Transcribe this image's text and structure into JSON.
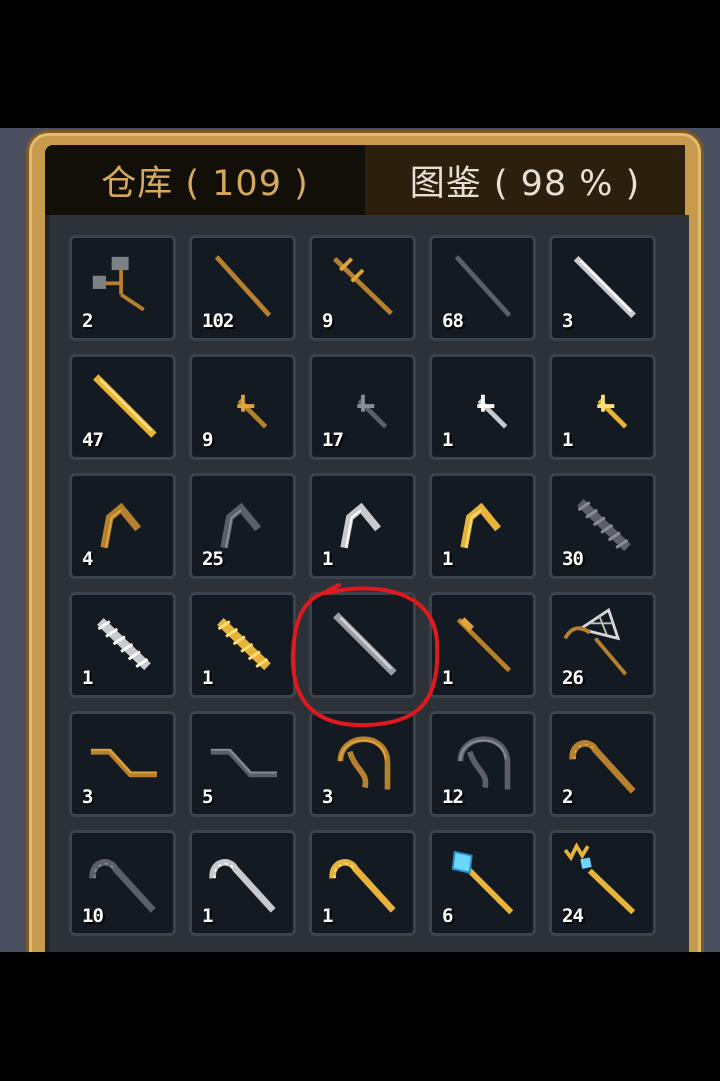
{
  "tabs": [
    {
      "label": "仓库 ( 109 )",
      "active": true
    },
    {
      "label": "图鉴 ( 98 % )",
      "active": false
    }
  ],
  "colors": {
    "frame_gold": "#c89a4e",
    "tab_active_text": "#d6a85a",
    "slot_bg": "#141a22",
    "highlight": "#e0191f"
  },
  "items": [
    {
      "icon": "hammer-icon",
      "count": "2"
    },
    {
      "icon": "wooden-staff-icon",
      "count": "102"
    },
    {
      "icon": "barbed-wooden-spear-icon",
      "count": "9"
    },
    {
      "icon": "iron-rod-icon",
      "count": "68"
    },
    {
      "icon": "steel-rod-icon",
      "count": "3"
    },
    {
      "icon": "golden-rod-icon",
      "count": "47"
    },
    {
      "icon": "wooden-dart-icon",
      "count": "9"
    },
    {
      "icon": "iron-dart-icon",
      "count": "17"
    },
    {
      "icon": "silver-dart-icon",
      "count": "1"
    },
    {
      "icon": "golden-dart-icon",
      "count": "1"
    },
    {
      "icon": "wooden-hook-icon",
      "count": "4"
    },
    {
      "icon": "iron-hook-icon",
      "count": "25"
    },
    {
      "icon": "silver-hook-icon",
      "count": "1"
    },
    {
      "icon": "golden-hook-icon",
      "count": "1"
    },
    {
      "icon": "spiked-club-icon",
      "count": "30"
    },
    {
      "icon": "silver-spiked-club-icon",
      "count": "1"
    },
    {
      "icon": "golden-spiked-club-icon",
      "count": "1"
    },
    {
      "icon": "steel-bar-icon",
      "count": "",
      "highlighted": true
    },
    {
      "icon": "wooden-spear-icon",
      "count": "1"
    },
    {
      "icon": "net-icon",
      "count": "26"
    },
    {
      "icon": "wooden-stairs-icon",
      "count": "3"
    },
    {
      "icon": "iron-stairs-icon",
      "count": "5"
    },
    {
      "icon": "wooden-whip-icon",
      "count": "3"
    },
    {
      "icon": "iron-whip-icon",
      "count": "12"
    },
    {
      "icon": "wooden-cane-icon",
      "count": "2"
    },
    {
      "icon": "iron-cane-icon",
      "count": "10"
    },
    {
      "icon": "silver-cane-icon",
      "count": "1"
    },
    {
      "icon": "golden-cane-icon",
      "count": "1"
    },
    {
      "icon": "ice-crystal-staff-icon",
      "count": "6"
    },
    {
      "icon": "crown-crystal-staff-icon",
      "count": "24"
    }
  ]
}
